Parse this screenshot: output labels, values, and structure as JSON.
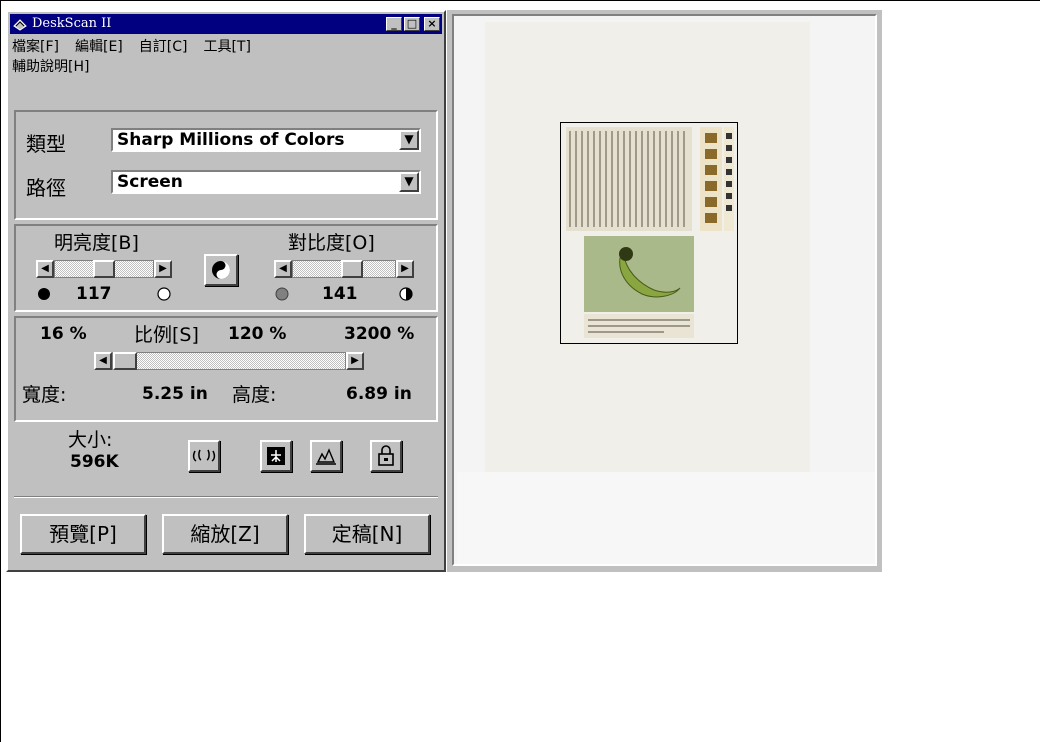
{
  "window": {
    "title": "DeskScan II",
    "controls": {
      "minimize": "_",
      "maximize": "□",
      "close": "×"
    }
  },
  "menu": [
    "檔案[F]",
    "編輯[E]",
    "自訂[C]",
    "工具[T]",
    "輔助說明[H]"
  ],
  "type_row": {
    "label": "類型",
    "value": "Sharp Millions of Colors"
  },
  "path_row": {
    "label": "路徑",
    "value": "Screen"
  },
  "brightness": {
    "label": "明亮度[B]",
    "value": "117"
  },
  "contrast": {
    "label": "對比度[O]",
    "value": "141"
  },
  "scale": {
    "min": "16 %",
    "label": "比例[S]",
    "current": "120 %",
    "max": "3200 %"
  },
  "dimensions": {
    "width_label": "寬度:",
    "width_value": "5.25 in",
    "height_label": "高度:",
    "height_value": "6.89 in"
  },
  "size": {
    "label": "大小:",
    "value": "596K"
  },
  "buttons": {
    "preview": "預覽[P]",
    "zoom": "縮放[Z]",
    "final": "定稿[N]"
  },
  "icons": {
    "arrow_left": "◀",
    "arrow_right": "▶",
    "dropdown": "▼"
  }
}
